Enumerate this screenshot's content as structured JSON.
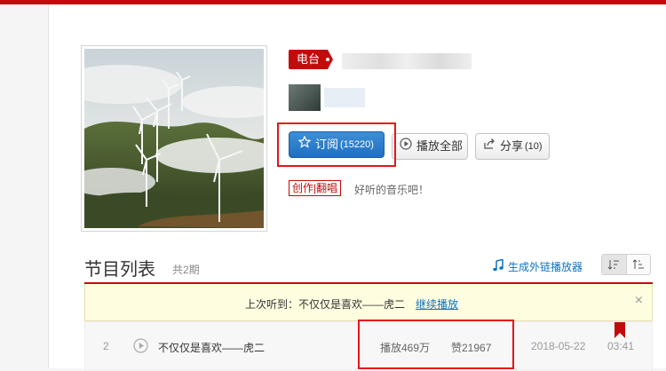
{
  "header": {
    "tag": "电台",
    "description_category": "创作|翻唱",
    "description_text": "好听的音乐吧！"
  },
  "buttons": {
    "subscribe_label": "订阅",
    "subscribe_count": "(15220)",
    "play_all_label": "播放全部",
    "share_label": "分享",
    "share_count": "(10)"
  },
  "program_list": {
    "title": "节目列表",
    "count": "共2期",
    "generate_player_label": "生成外链播放器",
    "notice": {
      "text": "上次听到：不仅仅是喜欢——虎二",
      "link": "继续播放",
      "close": "×"
    },
    "rows": [
      {
        "index": "2",
        "title": "不仅仅是喜欢——虎二",
        "plays": "播放469万",
        "likes": "赞21967",
        "date": "2018-05-22",
        "duration": "03:41"
      }
    ]
  },
  "colors": {
    "brand_red": "#c20c0c",
    "link_blue": "#0c73c2",
    "highlight_red": "#e8141b"
  },
  "icons": {
    "subscribe": "star-icon",
    "play_all": "play-circle-icon",
    "share": "share-icon",
    "generate": "music-note-icon",
    "sort_asc": "sort-asc-icon",
    "sort_desc": "sort-desc-icon",
    "row_play": "play-circle-icon",
    "bookmark": "bookmark-icon"
  }
}
